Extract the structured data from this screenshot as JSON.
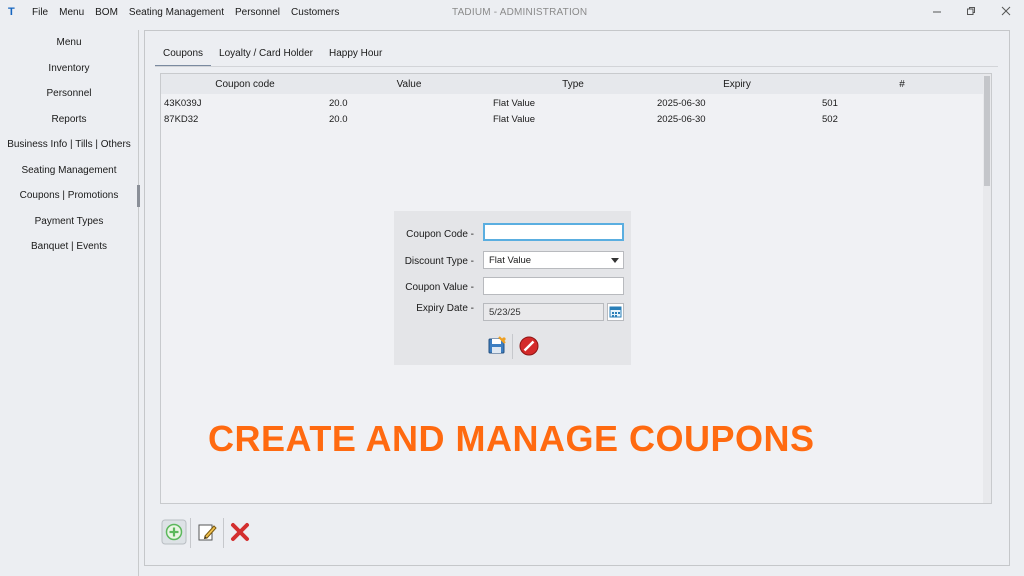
{
  "app": {
    "logo": "T",
    "window_title": "TADIUM -  ADMINISTRATION",
    "menu": [
      "File",
      "Menu",
      "BOM",
      "Seating Management",
      "Personnel",
      "Customers"
    ]
  },
  "sidebar": {
    "items": [
      {
        "label": "Menu"
      },
      {
        "label": "Inventory"
      },
      {
        "label": "Personnel"
      },
      {
        "label": "Reports"
      },
      {
        "label": "Business Info | Tills | Others"
      },
      {
        "label": "Seating Management"
      },
      {
        "label": "Coupons | Promotions"
      },
      {
        "label": "Payment Types"
      },
      {
        "label": "Banquet | Events"
      }
    ],
    "active_index": 6
  },
  "tabs": [
    {
      "label": "Coupons"
    },
    {
      "label": "Loyalty / Card Holder"
    },
    {
      "label": "Happy Hour"
    }
  ],
  "table": {
    "columns": [
      "Coupon code",
      "Value",
      "Type",
      "Expiry",
      "#"
    ],
    "rows": [
      [
        "43K039J",
        "20.0",
        "Flat Value",
        "2025-06-30",
        "501"
      ],
      [
        "87KD32",
        "20.0",
        "Flat Value",
        "2025-06-30",
        "502"
      ]
    ]
  },
  "form": {
    "coupon_code_label": "Coupon Code -",
    "coupon_code_value": "",
    "discount_type_label": "Discount Type -",
    "discount_type_value": "Flat Value",
    "coupon_value_label": "Coupon Value -",
    "coupon_value_value": "",
    "expiry_date_label": "Expiry Date -",
    "expiry_date_value": "5/23/25"
  },
  "overlay": {
    "caption": "CREATE AND MANAGE COUPONS",
    "color": "#ff6a10"
  },
  "toolbar": {
    "icons": [
      "add-icon",
      "edit-icon",
      "delete-icon"
    ]
  },
  "colors": {
    "accent_focus": "#5aaee0",
    "add_green": "#5cb85c",
    "delete_red": "#d32f2f"
  }
}
